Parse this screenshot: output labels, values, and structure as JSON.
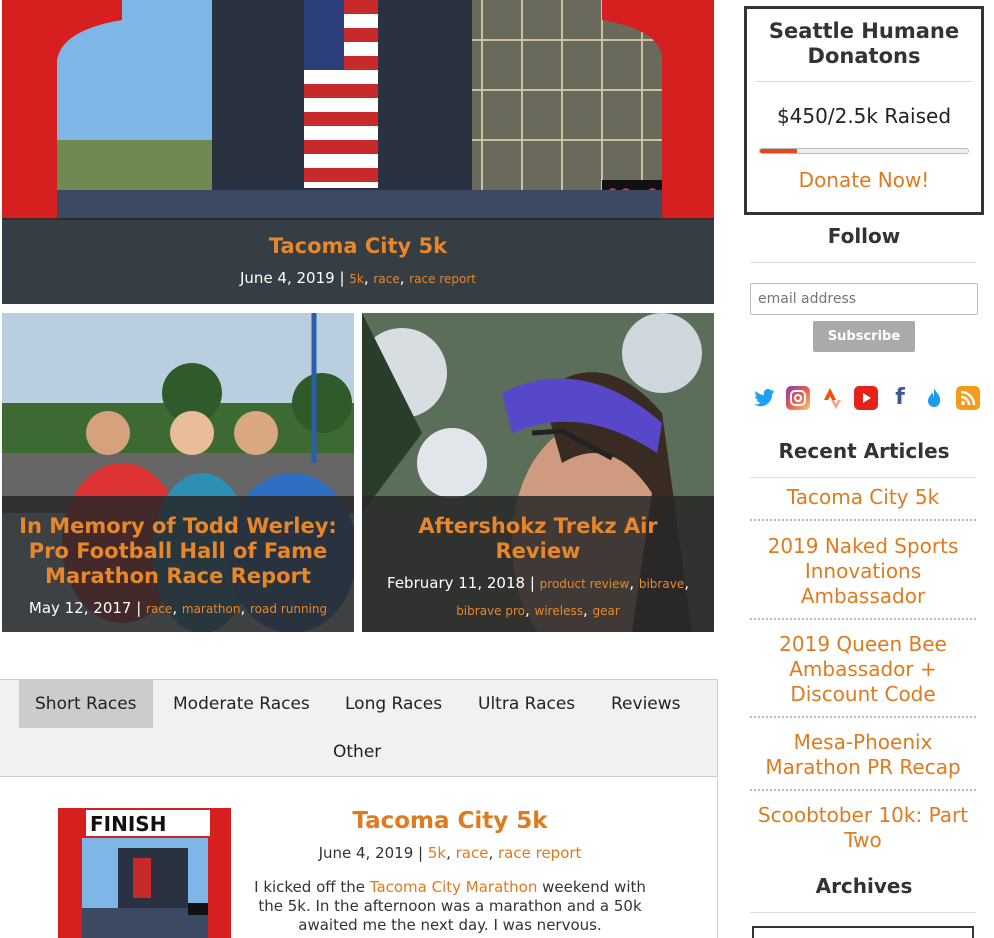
{
  "featured": [
    {
      "title": "Tacoma City 5k",
      "date": "June 4, 2019",
      "tags": [
        "5k",
        "race",
        "race report"
      ]
    },
    {
      "title": "In Memory of Todd Werley: Pro Football Hall of Fame Marathon Race Report",
      "date": "May 12, 2017",
      "tags": [
        "race",
        "marathon",
        "road running"
      ]
    },
    {
      "title": "Aftershokz Trekz Air Review",
      "date": "February 11, 2018",
      "tags": [
        "product review",
        "bibrave",
        "bibrave pro",
        "wireless",
        "gear"
      ]
    }
  ],
  "tabs": [
    "Short Races",
    "Moderate Races",
    "Long Races",
    "Ultra Races",
    "Reviews",
    "Other"
  ],
  "post": {
    "title": "Tacoma City 5k",
    "date": "June 4, 2019",
    "tags": [
      "5k",
      "race",
      "race report"
    ],
    "excerpt_1": "I kicked off the ",
    "excerpt_link": "Tacoma City Marathon",
    "excerpt_2": " weekend with the 5k. In the afternoon was a marathon and a 50k awaited me the next day. I was nervous.",
    "thumb_sign": "FINISH"
  },
  "sidebar": {
    "donation": {
      "title": "Seattle Humane Donatons",
      "raised": "$450/2.5k Raised",
      "progress_fraction": 0.18,
      "button": "Donate Now!"
    },
    "follow": {
      "heading": "Follow",
      "email_placeholder": "email address",
      "subscribe": "Subscribe"
    },
    "socials": [
      "twitter-icon",
      "instagram-icon",
      "strava-icon",
      "youtube-icon",
      "facebook-icon",
      "flame-icon",
      "rss-icon"
    ],
    "recent_heading": "Recent Articles",
    "recent": [
      "Tacoma City 5k",
      "2019 Naked Sports Innovations Ambassador",
      "2019 Queen Bee Ambassador + Discount Code",
      "Mesa-Phoenix Marathon PR Recap",
      "Scoobtober 10k: Part Two"
    ],
    "archives_heading": "Archives"
  },
  "colors": {
    "accent": "#e07a1f",
    "overlay": "#282828",
    "progress": "#e8461a"
  }
}
